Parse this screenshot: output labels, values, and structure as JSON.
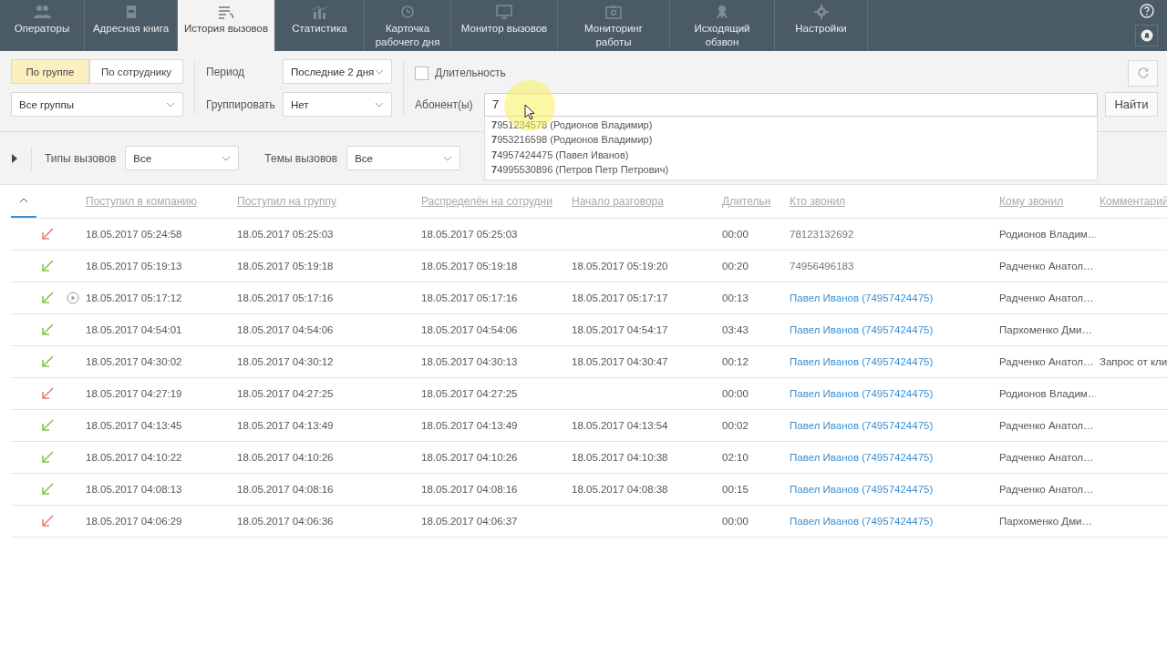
{
  "tabs": [
    {
      "label": "Операторы",
      "selected": false
    },
    {
      "label": "Адресная книга",
      "selected": false
    },
    {
      "label": "История вызовов",
      "selected": true
    },
    {
      "label": "Статистика",
      "selected": false
    },
    {
      "label": "Карточка рабочего дня",
      "selected": false
    },
    {
      "label": "Монитор вызовов",
      "selected": false
    },
    {
      "label": "Мониторинг работы",
      "selected": false
    },
    {
      "label": "Исходящий обзвон",
      "selected": false
    },
    {
      "label": "Настройки",
      "selected": false
    }
  ],
  "filters": {
    "mode_toggle": [
      {
        "label": "По группе",
        "selected": true
      },
      {
        "label": "По сотруднику",
        "selected": false
      }
    ],
    "group_select": "Все группы",
    "period": {
      "label": "Период",
      "value": "Последние 2 дня"
    },
    "grouping": {
      "label": "Группировать",
      "value": "Нет"
    },
    "duration": {
      "label": "Длительность",
      "checked": false
    },
    "subscriber": {
      "label": "Абонент(ы)",
      "value": "7"
    },
    "suggestions": [
      "**7**951234578 (Родионов Владимир)",
      "**7**953216598 (Родионов Владимир)",
      "**7**4957424475 (Павел Иванов)",
      "**7**4995530896 (Петров Петр Петрович)"
    ],
    "find_button": "Найти",
    "call_types": {
      "label": "Типы вызовов",
      "value": "Все"
    },
    "call_topics": {
      "label": "Темы вызовов",
      "value": "Все"
    }
  },
  "table": {
    "columns": [
      "Поступил в компанию",
      "Поступил на группу",
      "Распределён на сотрудни",
      "Начало разговора",
      "Длительн",
      "Кто звонил",
      "Кому звонил",
      "Комментарий"
    ],
    "rows": [
      {
        "answered": false,
        "recording": false,
        "received": "18.05.2017 05:24:58",
        "to_group": "18.05.2017 05:25:03",
        "assigned": "18.05.2017 05:25:03",
        "talk_start": "",
        "duration": "00:00",
        "caller": "78123132692",
        "caller_link": false,
        "callee": "Родионов Владим…",
        "comment": ""
      },
      {
        "answered": true,
        "recording": false,
        "received": "18.05.2017 05:19:13",
        "to_group": "18.05.2017 05:19:18",
        "assigned": "18.05.2017 05:19:18",
        "talk_start": "18.05.2017 05:19:20",
        "duration": "00:20",
        "caller": "74956496183",
        "caller_link": false,
        "callee": "Радченко Анатол…",
        "comment": ""
      },
      {
        "answered": true,
        "recording": true,
        "received": "18.05.2017 05:17:12",
        "to_group": "18.05.2017 05:17:16",
        "assigned": "18.05.2017 05:17:16",
        "talk_start": "18.05.2017 05:17:17",
        "duration": "00:13",
        "caller": "Павел Иванов (74957424475)",
        "caller_link": true,
        "callee": "Радченко Анатол…",
        "comment": ""
      },
      {
        "answered": true,
        "recording": false,
        "received": "18.05.2017 04:54:01",
        "to_group": "18.05.2017 04:54:06",
        "assigned": "18.05.2017 04:54:06",
        "talk_start": "18.05.2017 04:54:17",
        "duration": "03:43",
        "caller": "Павел Иванов (74957424475)",
        "caller_link": true,
        "callee": "Пархоменко Дми…",
        "comment": ""
      },
      {
        "answered": true,
        "recording": false,
        "received": "18.05.2017 04:30:02",
        "to_group": "18.05.2017 04:30:12",
        "assigned": "18.05.2017 04:30:13",
        "talk_start": "18.05.2017 04:30:47",
        "duration": "00:12",
        "caller": "Павел Иванов (74957424475)",
        "caller_link": true,
        "callee": "Радченко Анатол…",
        "comment": "Запрос от кли"
      },
      {
        "answered": false,
        "recording": false,
        "received": "18.05.2017 04:27:19",
        "to_group": "18.05.2017 04:27:25",
        "assigned": "18.05.2017 04:27:25",
        "talk_start": "",
        "duration": "00:00",
        "caller": "Павел Иванов (74957424475)",
        "caller_link": true,
        "callee": "Родионов Владим…",
        "comment": ""
      },
      {
        "answered": true,
        "recording": false,
        "received": "18.05.2017 04:13:45",
        "to_group": "18.05.2017 04:13:49",
        "assigned": "18.05.2017 04:13:49",
        "talk_start": "18.05.2017 04:13:54",
        "duration": "00:02",
        "caller": "Павел Иванов (74957424475)",
        "caller_link": true,
        "callee": "Радченко Анатол…",
        "comment": ""
      },
      {
        "answered": true,
        "recording": false,
        "received": "18.05.2017 04:10:22",
        "to_group": "18.05.2017 04:10:26",
        "assigned": "18.05.2017 04:10:26",
        "talk_start": "18.05.2017 04:10:38",
        "duration": "02:10",
        "caller": "Павел Иванов (74957424475)",
        "caller_link": true,
        "callee": "Радченко Анатол…",
        "comment": ""
      },
      {
        "answered": true,
        "recording": false,
        "received": "18.05.2017 04:08:13",
        "to_group": "18.05.2017 04:08:16",
        "assigned": "18.05.2017 04:08:16",
        "talk_start": "18.05.2017 04:08:38",
        "duration": "00:15",
        "caller": "Павел Иванов (74957424475)",
        "caller_link": true,
        "callee": "Радченко Анатол…",
        "comment": ""
      },
      {
        "answered": false,
        "recording": false,
        "received": "18.05.2017 04:06:29",
        "to_group": "18.05.2017 04:06:36",
        "assigned": "18.05.2017 04:06:37",
        "talk_start": "",
        "duration": "00:00",
        "caller": "Павел Иванов (74957424475)",
        "caller_link": true,
        "callee": "Пархоменко Дми…",
        "comment": ""
      }
    ]
  }
}
